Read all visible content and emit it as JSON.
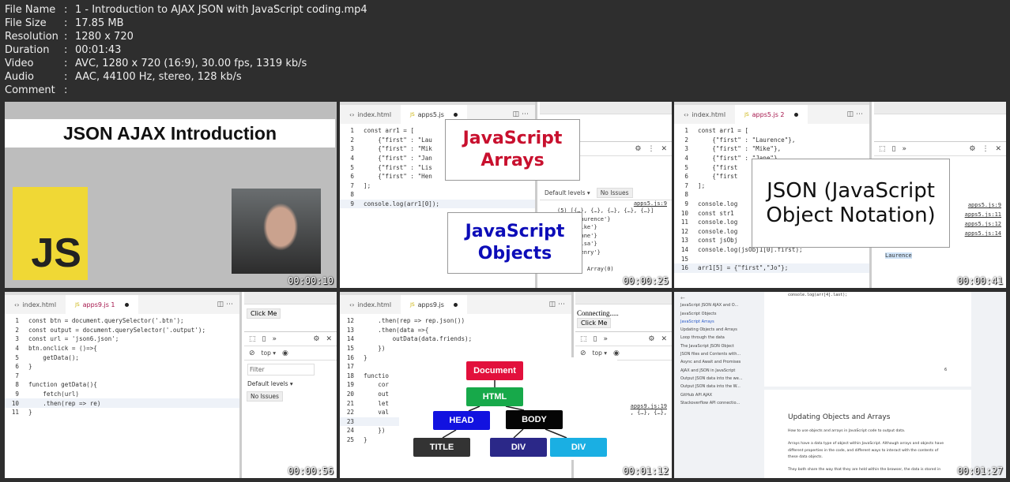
{
  "info": [
    {
      "key": "File Name",
      "value": "1 - Introduction to AJAX JSON with JavaScript coding.mp4"
    },
    {
      "key": "File Size",
      "value": "17.85 MB"
    },
    {
      "key": "Resolution",
      "value": "1280 x 720"
    },
    {
      "key": "Duration",
      "value": "00:01:43"
    },
    {
      "key": "Video",
      "value": "AVC, 1280 x 720 (16:9), 30.00 fps, 1319 kb/s"
    },
    {
      "key": "Audio",
      "value": "AAC, 44100 Hz, stereo, 128 kb/s"
    },
    {
      "key": "Comment",
      "value": ""
    }
  ],
  "sep": ":",
  "thumbs": [
    {
      "time": "00:00:10",
      "title": "JSON AJAX Introduction",
      "logo": "JS"
    },
    {
      "time": "00:00:25",
      "tab1": "index.html",
      "tab2": "apps5.js",
      "js": "JS",
      "code": [
        [
          "1",
          "const arr1 = ["
        ],
        [
          "2",
          "    {\"first\" : \"Lau"
        ],
        [
          "3",
          "    {\"first\" : \"Mik"
        ],
        [
          "4",
          "    {\"first\" : \"Jan"
        ],
        [
          "5",
          "    {\"first\" : \"Lis"
        ],
        [
          "6",
          "    {\"first\" : \"Hen"
        ],
        [
          "7",
          "];"
        ],
        [
          "8",
          ""
        ],
        [
          "9",
          "console.log(arr1[0]);"
        ]
      ],
      "levels": "Default levels ▾",
      "issues": "No Issues",
      "src": "apps5.js:9",
      "console": [
        "(5) [{…}, {…}, {…}, {…}, {…}]",
        "rst: 'Laurence'}",
        "rst: 'Mike'}",
        "rst: 'Jane'}",
        "rst: 'Lisa'}",
        "rst: 'Henry'}",
        ": 5",
        "otype]]: Array(0)"
      ],
      "overlay1": "JavaScript Arrays",
      "overlay2": "JavaScript Objects"
    },
    {
      "time": "00:00:41",
      "tab1": "index.html",
      "tab2": "apps5.js 2",
      "js": "JS",
      "code": [
        [
          "1",
          "const arr1 = ["
        ],
        [
          "2",
          "    {\"first\" : \"Laurence\"},"
        ],
        [
          "3",
          "    {\"first\" : \"Mike\"},"
        ],
        [
          "4",
          "    {\"first\" : \"Jane\"},"
        ],
        [
          "5",
          "    {\"first"
        ],
        [
          "6",
          "    {\"first"
        ],
        [
          "7",
          "];"
        ],
        [
          "8",
          ""
        ],
        [
          "9",
          "console.log"
        ],
        [
          "10",
          "const str1"
        ],
        [
          "11",
          "console.log"
        ],
        [
          "12",
          "console.log"
        ],
        [
          "13",
          "const jsObj"
        ],
        [
          "14",
          "console.log(jsObj1[0].first);"
        ],
        [
          "15",
          ""
        ],
        [
          "16",
          "arr1[5] = {\"first\",\"Jo\"};"
        ]
      ],
      "srcs": [
        "apps5.js:9",
        "apps5.js:11",
        "apps5.js:12",
        "apps5.js:14"
      ],
      "issues": "sues",
      "laurence": "Laurence",
      "overlay": "JSON (JavaScript Object Notation)"
    },
    {
      "time": "00:00:56",
      "tab1": "index.html",
      "tab2": "apps9.js 1",
      "js": "JS",
      "code": [
        [
          "1",
          "const btn = document.querySelector('.btn');"
        ],
        [
          "2",
          "const output = document.querySelector('.output');"
        ],
        [
          "3",
          "const url = 'json6.json';"
        ],
        [
          "4",
          "btn.onclick = ()=>{"
        ],
        [
          "5",
          "    getData();"
        ],
        [
          "6",
          "}"
        ],
        [
          "7",
          ""
        ],
        [
          "8",
          "function getData(){"
        ],
        [
          "9",
          "    fetch(url)"
        ],
        [
          "10",
          "    .then(rep => re)"
        ],
        [
          "11",
          "}"
        ]
      ],
      "button": "Click Me",
      "top": "top ▾",
      "filter": "Filter",
      "levels": "Default levels ▾",
      "issues": "No Issues"
    },
    {
      "time": "00:01:12",
      "tab1": "index.html",
      "tab2": "apps9.js",
      "js": "JS",
      "code": [
        [
          "12",
          "    .then(rep => rep.json())"
        ],
        [
          "13",
          "    .then(data =>{"
        ],
        [
          "14",
          "        outData(data.friends);"
        ],
        [
          "15",
          "    })"
        ],
        [
          "16",
          "}"
        ],
        [
          "17",
          ""
        ],
        [
          "18",
          "functio"
        ],
        [
          "19",
          "    cor"
        ],
        [
          "20",
          "    out"
        ],
        [
          "21",
          "    let"
        ],
        [
          "22",
          "    val"
        ],
        [
          "23",
          ""
        ],
        [
          "24",
          "    })"
        ],
        [
          "25",
          "}"
        ]
      ],
      "connecting": "Connecting.....",
      "button": "Click Me",
      "top": "top ▾",
      "src": "apps9.js:19",
      "console": ", {…}, {…},",
      "nodes": [
        "Document",
        "HTML",
        "HEAD",
        "BODY",
        "TITLE",
        "DIV",
        "DIV"
      ],
      "colors": [
        "#e2103c",
        "#17a94a",
        "#1212e0",
        "#050505",
        "#333333",
        "#2b2888",
        "#1aafe3"
      ]
    },
    {
      "time": "00:01:27",
      "back": "←",
      "nav": [
        "JavaScript JSON AJAX and O...",
        "JavaScript Objects",
        "JavaScript Arrays",
        "Updating Objects and Arrays",
        "Loop through the data",
        "The JavaScript JSON Object",
        "JSON files and Contents with...",
        "Async and Await and Promises",
        "AJAX and JSON in JavaScript",
        "Output JSON data into the we...",
        "Output JSON data into the W...",
        "GitHub API AJAX",
        "Stackoverflow API connectio..."
      ],
      "code": "console.log(arr[4].last);",
      "page": "6",
      "heading": "Updating Objects and Arrays",
      "p1": "How to use objects and arrays in JavaScript code to output data.",
      "p2": "Arrays have a data type of object within JavaScript.  Although arrays and objects have different properties in the code, and different ways to interact with the contents of these data objects.",
      "p3": "They both share the way that they are held within the browser, the data is stored in"
    }
  ]
}
